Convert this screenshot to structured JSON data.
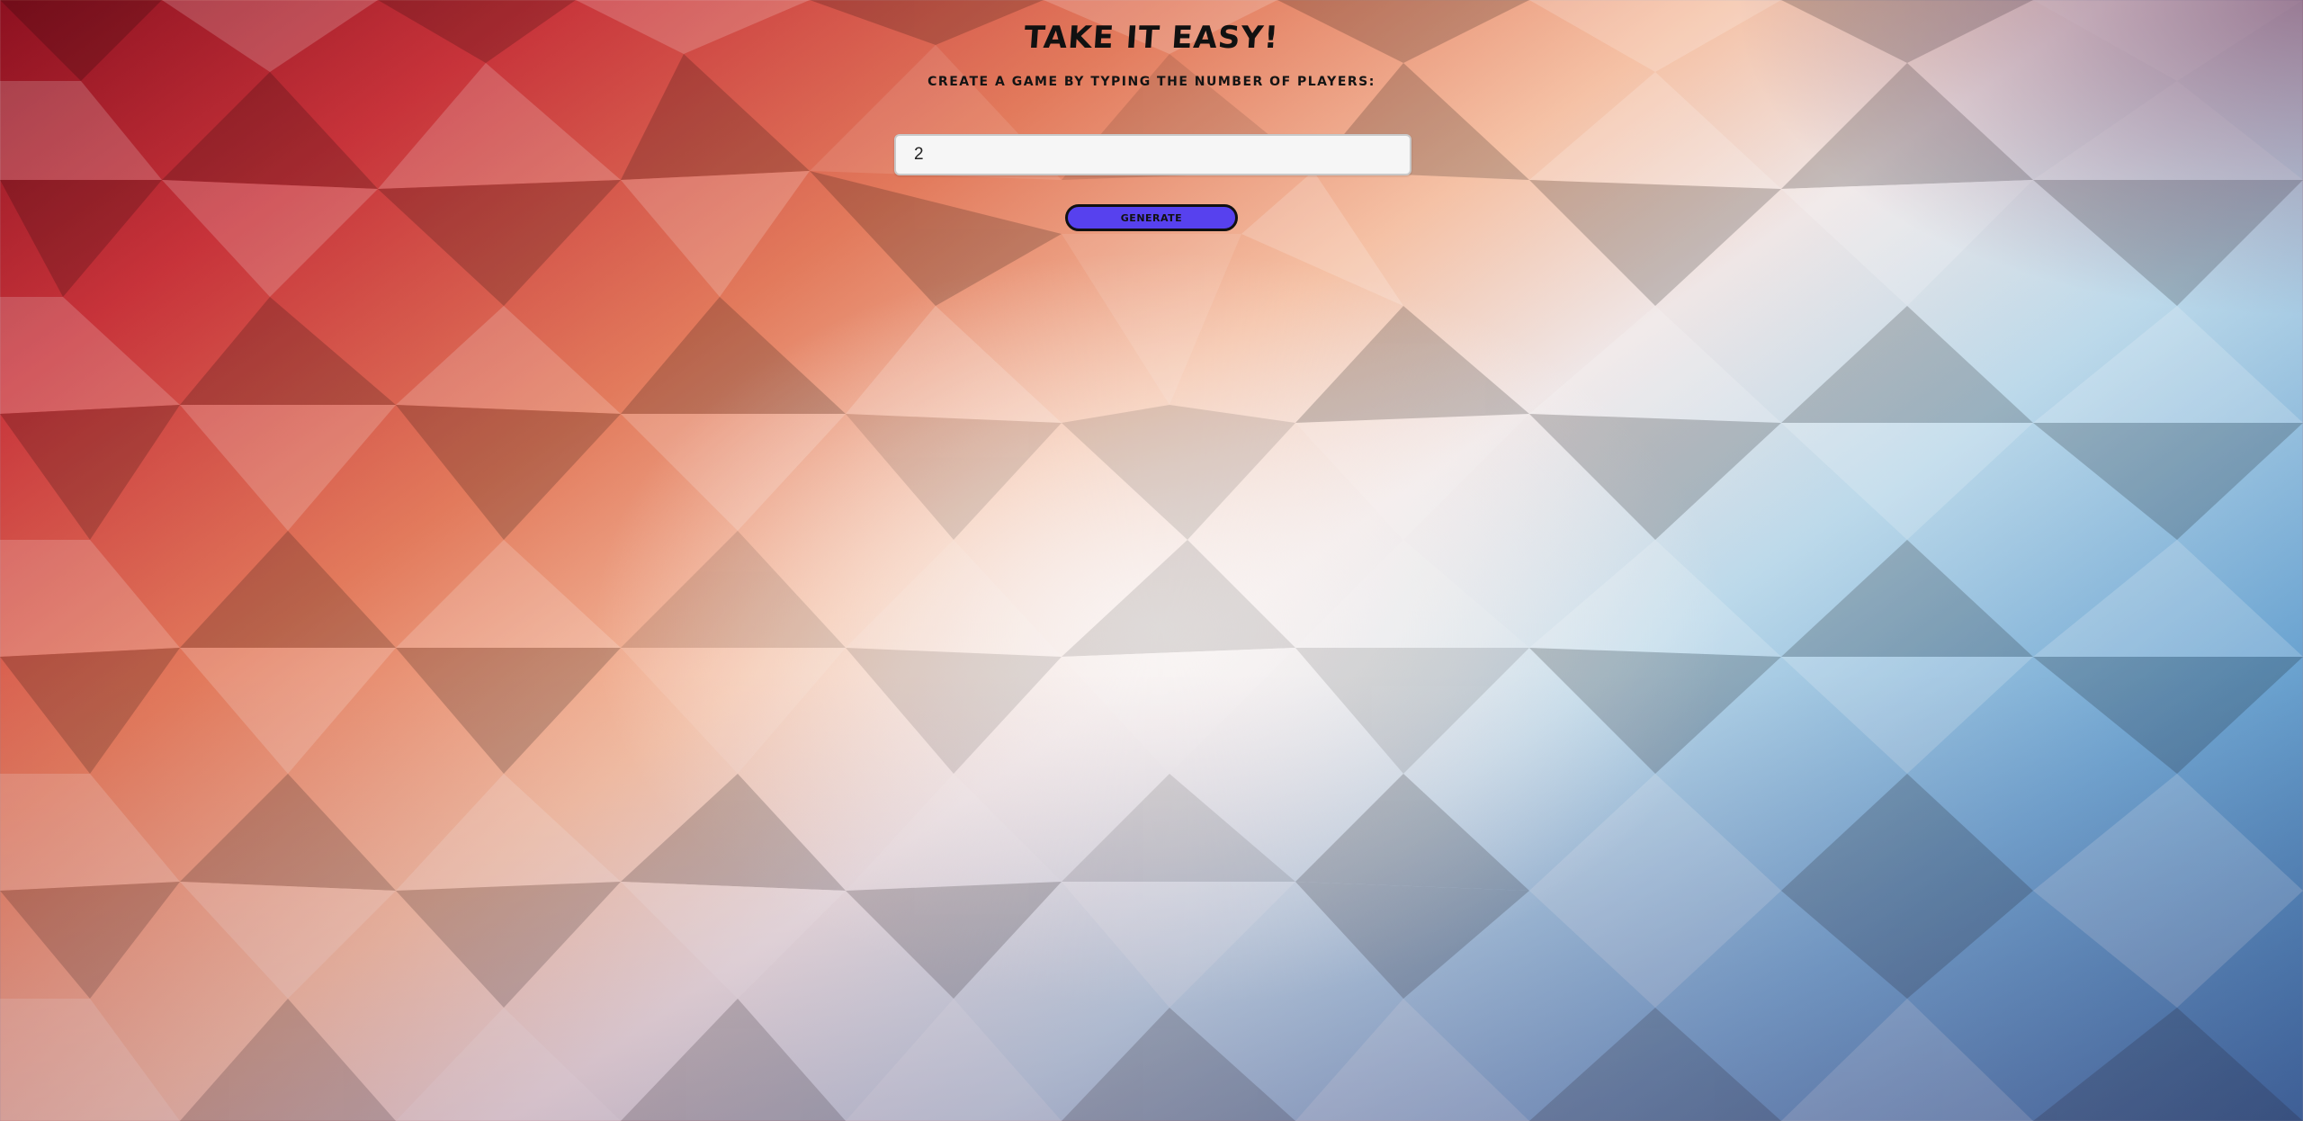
{
  "page": {
    "title": "TAKE IT EASY!",
    "subtitle": "CREATE A GAME BY TYPING THE NUMBER OF PLAYERS:"
  },
  "form": {
    "players_value": "2",
    "generate_label": "GENERATE"
  },
  "colors": {
    "button_background": "#5741ee",
    "input_background": "#f6f6f6",
    "text": "#111111",
    "background_top_left": "#8c1020",
    "background_center": "#efe6e6",
    "background_bottom_right": "#2b6aa6"
  }
}
